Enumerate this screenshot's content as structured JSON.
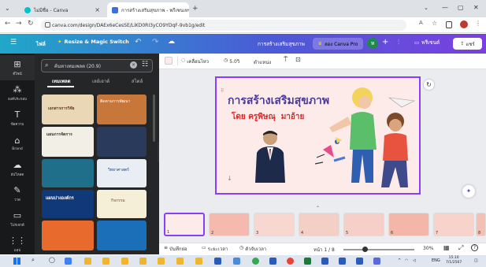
{
  "browser": {
    "tabs": [
      {
        "title": "ไม่มีชื่อ - Canva",
        "close": "×"
      },
      {
        "title": "การสร้างเสริมสุขภาพ - พรีเซนเทชั่น",
        "close": "×"
      }
    ],
    "new_tab": "+",
    "window_controls": [
      "⌄",
      "—",
      "▢",
      "✕"
    ],
    "url": "canva.com/design/DAEx6eCesSE/LiKD0RI3yCO9YDqF-9vb1g/edit"
  },
  "canva_header": {
    "home": "หน้าหลัก",
    "file": "ไฟล์",
    "resize": "Resize & Magic Switch",
    "undo": "↶",
    "redo": "↷",
    "cloud": "☁",
    "doc_title": "การสร้างเสริมสุขภาพ",
    "try_pro": "ลอง Canva Pro",
    "avatar": "ห",
    "add": "+",
    "present": "พรีเซนต์",
    "share": "แชร์"
  },
  "rail": {
    "items": [
      "ดีไซน์",
      "องค์ประกอบ",
      "ข้อความ",
      "Brand",
      "อัปโหลด",
      "วาด",
      "โปรเจกต์",
      "แอป"
    ]
  },
  "panel": {
    "search_placeholder": "ค้นหาเทมเพลต (20.9)",
    "tabs": [
      "เทมเพลต",
      "เลย์เอาต์",
      "สไตล์"
    ],
    "thumbs": [
      {
        "caption": "เอกสารการวิจัย",
        "color": "#e9d7b5"
      },
      {
        "caption": "ติดตามการพัฒนา",
        "color": "#c8773b"
      },
      {
        "caption": "แผนการจัดการ",
        "color": "#f2efe6"
      },
      {
        "caption": "",
        "color": "#2a3a5a"
      },
      {
        "caption": "",
        "color": "#1f6f8b"
      },
      {
        "caption": "วิทยาศาสตร์",
        "color": "#e8eef4"
      },
      {
        "caption": "แผนบ่างองค์กร",
        "color": "#10397a"
      },
      {
        "caption": "กิจกรรม",
        "color": "#f5efd8"
      },
      {
        "caption": "",
        "color": "#e86a2c"
      },
      {
        "caption": "",
        "color": "#1b6fb8"
      }
    ]
  },
  "toolbar": {
    "color_swatch": "#fdebea",
    "animate": "เคลื่อนไหว",
    "duration": "5.0วิ",
    "position": "ตำแหน่ง"
  },
  "slide": {
    "title": "การสร้างเสริมสุขภาพ",
    "subtitle": "โดย ครูพิษณุ  มาอ้าย",
    "bg": "#fdebea",
    "title_color": "#4a3b9a",
    "subtitle_color": "#d42a2a"
  },
  "strip": {
    "page_numbers": [
      "1",
      "2",
      "3",
      "4",
      "5",
      "6",
      "7",
      "8"
    ]
  },
  "bottombar": {
    "notes": "บันทึกย่อ",
    "timer": "ระยะเวลา",
    "record": "ตัวจับเวลา",
    "page_indicator": "หน้า 1 / 8",
    "zoom": "30%"
  },
  "taskbar": {
    "lang": "ENG",
    "time": "15:10",
    "date": "7/1/2567"
  },
  "colors": {
    "accent": "#8b3dff",
    "canva_teal": "#1fa8c9"
  }
}
